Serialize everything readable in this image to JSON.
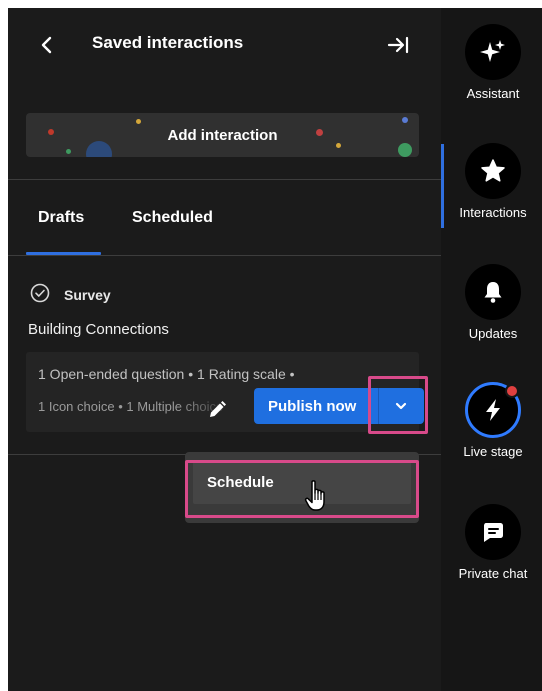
{
  "header": {
    "title": "Saved interactions",
    "back_icon": "chevron-left-icon",
    "collapse_icon": "arrow-right-to-bar-icon"
  },
  "add_interaction": {
    "label": "Add interaction"
  },
  "tabs": [
    {
      "label": "Drafts",
      "active": true
    },
    {
      "label": "Scheduled",
      "active": false
    }
  ],
  "draft": {
    "type_label": "Survey",
    "title": "Building Connections",
    "summary_line1": "1 Open-ended question  •  1 Rating scale  •",
    "summary_line2": "1 Icon choice  •  1 Multiple choice",
    "publish_label": "Publish now",
    "edit_icon": "pencil-icon",
    "dropdown_icon": "chevron-down-icon"
  },
  "dropdown_menu": {
    "items": [
      {
        "label": "Schedule"
      }
    ]
  },
  "rail": {
    "items": [
      {
        "label": "Assistant",
        "icon": "sparkle-icon"
      },
      {
        "label": "Interactions",
        "icon": "star-icon",
        "active": true
      },
      {
        "label": "Updates",
        "icon": "bell-icon"
      },
      {
        "label": "Live stage",
        "icon": "lightning-icon",
        "live": true
      },
      {
        "label": "Private chat",
        "icon": "chat-bubble-icon"
      }
    ]
  },
  "colors": {
    "accent": "#1f6fe0",
    "highlight": "#d84a8a",
    "panel_bg": "#1b1b1b",
    "live_dot": "#e04040"
  }
}
